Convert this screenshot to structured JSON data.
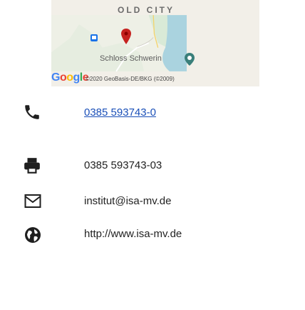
{
  "map": {
    "district_label": "OLD CITY",
    "place_label": "Schloss Schwerin",
    "google_logo": "Google",
    "attribution": "©2020 GeoBasis-DE/BKG (©2009)"
  },
  "contacts": [
    {
      "icon": "phone-icon",
      "text": "0385 593743-0",
      "is_link": true
    },
    {
      "icon": "printer-icon",
      "text": "0385 593743-03",
      "is_link": false
    },
    {
      "icon": "envelope-icon",
      "text": "institut@isa-mv.de",
      "is_link": false
    },
    {
      "icon": "globe-icon",
      "text": "http://www.isa-mv.de",
      "is_link": false
    }
  ],
  "colors": {
    "icon": "#1f1f1f",
    "link": "#1a4fb8",
    "map_water": "#aad3df"
  }
}
